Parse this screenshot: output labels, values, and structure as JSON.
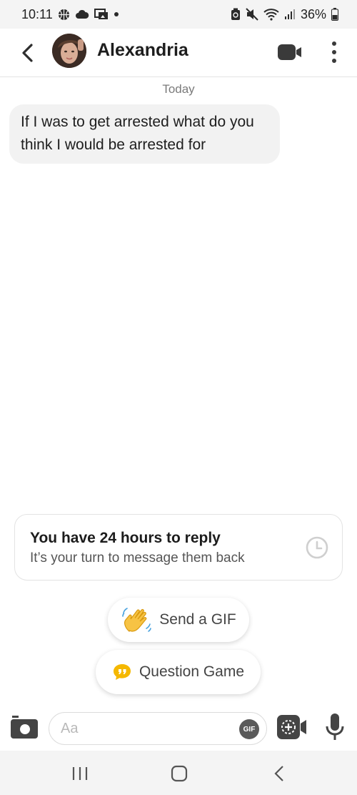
{
  "status_bar": {
    "time": "10:11",
    "battery": "36%"
  },
  "header": {
    "contact_name": "Alexandria"
  },
  "chat": {
    "date_separator": "Today",
    "messages": [
      {
        "text": "If I was to get arrested what do you think I would be arrested for",
        "direction": "incoming"
      }
    ]
  },
  "reply_card": {
    "title": "You have 24 hours to reply",
    "subtitle": "It’s your turn to message them back"
  },
  "suggestions": {
    "send_gif": "Send a GIF",
    "question_game": "Question Game"
  },
  "composer": {
    "placeholder": "Aa",
    "gif_label": "GIF"
  },
  "colors": {
    "bubble_bg": "#f2f2f2",
    "question_icon": "#f5b800",
    "wave_icon": "#f7c344"
  },
  "icons": {
    "status": [
      "basketball-icon",
      "cloud-icon",
      "photo-icon",
      "dot-icon",
      "battery-saver-icon",
      "mute-icon",
      "wifi-icon",
      "signal-icon",
      "battery-icon"
    ],
    "header": [
      "back-arrow-icon",
      "video-call-icon",
      "more-vertical-icon"
    ],
    "card": [
      "clock-icon"
    ],
    "suggestions": [
      "waving-hand-icon",
      "speech-bubble-quote-icon"
    ],
    "composer": [
      "camera-icon",
      "gif-icon",
      "video-note-icon",
      "microphone-icon"
    ],
    "nav": [
      "recent-apps-icon",
      "home-icon",
      "back-icon"
    ]
  }
}
